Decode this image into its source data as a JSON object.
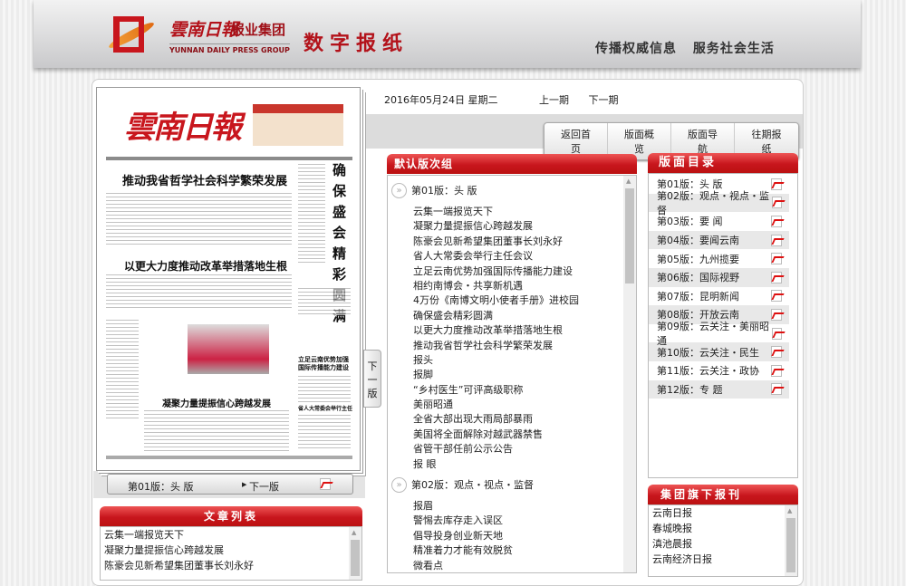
{
  "header": {
    "logo_name": "雲南日報",
    "logo_group": "报业集团",
    "logo_en": "YUNNAN DAILY PRESS GROUP",
    "title": "数字报纸",
    "slogan": "传播权威信息 服务社会生活"
  },
  "nav": {
    "date": "2016年05月24日 星期二",
    "prev_issue": "上一期",
    "next_issue": "下一期"
  },
  "toolbar": [
    "返回首页",
    "版面概览",
    "版面导航",
    "往期报纸"
  ],
  "paper_preview": {
    "masthead": "雲南日報",
    "headlines": [
      "推动我省哲学社会科学繁荣发展",
      "以更大力度推动改革举措落地生根",
      "确保盛会精彩圆满",
      "凝聚力量提振信心跨越发展",
      "立足云南优势加强国际传播能力建设",
      "省人大常委会举行主任会议"
    ]
  },
  "next_page_tab": "下一版",
  "page_bar": {
    "current": "第01版：头 版",
    "next": "下一版"
  },
  "article_list": {
    "title": "文章列表",
    "items": [
      "云集一端报览天下",
      "凝聚力量提振信心跨越发展",
      "陈豪会见新希望集团董事长刘永好"
    ]
  },
  "default_group": {
    "title": "默认版次组",
    "sections": [
      {
        "label": "第01版：头 版",
        "articles": [
          "云集一端报览天下",
          "凝聚力量提振信心跨越发展",
          "陈豪会见新希望集团董事长刘永好",
          "省人大常委会举行主任会议",
          "立足云南优势加强国际传播能力建设",
          "相约南博会・共享新机遇",
          "4万份《南博文明小使者手册》进校园",
          "确保盛会精彩圆满",
          "以更大力度推动改革举措落地生根",
          "推动我省哲学社会科学繁荣发展",
          "报头",
          "报脚",
          "“乡村医生”可评高级职称",
          "美丽昭通",
          "全省大部出现大雨局部暴雨",
          "美国将全面解除对越武器禁售",
          "省管干部任前公示公告",
          "报 眼"
        ]
      },
      {
        "label": "第02版：观点・视点・监督",
        "articles": [
          "报眉",
          "警惕去库存走入误区",
          "倡导投身创业新天地",
          "精准着力才能有效脱贫",
          "微看点"
        ]
      }
    ]
  },
  "page_index": {
    "title": "版面目录",
    "pages": [
      "第01版：头 版",
      "第02版：观点・视点・监督",
      "第03版：要 闻",
      "第04版：要闻云南",
      "第05版：九州揽要",
      "第06版：国际视野",
      "第07版：昆明新闻",
      "第08版：开放云南",
      "第09版：云关注・美丽昭通",
      "第10版：云关注・民生",
      "第11版：云关注・政协",
      "第12版：专 题"
    ]
  },
  "group_papers": {
    "title": "集团旗下报刊",
    "items": [
      "云南日报",
      "春城晚报",
      "滇池晨报",
      "云南经济日报"
    ]
  }
}
